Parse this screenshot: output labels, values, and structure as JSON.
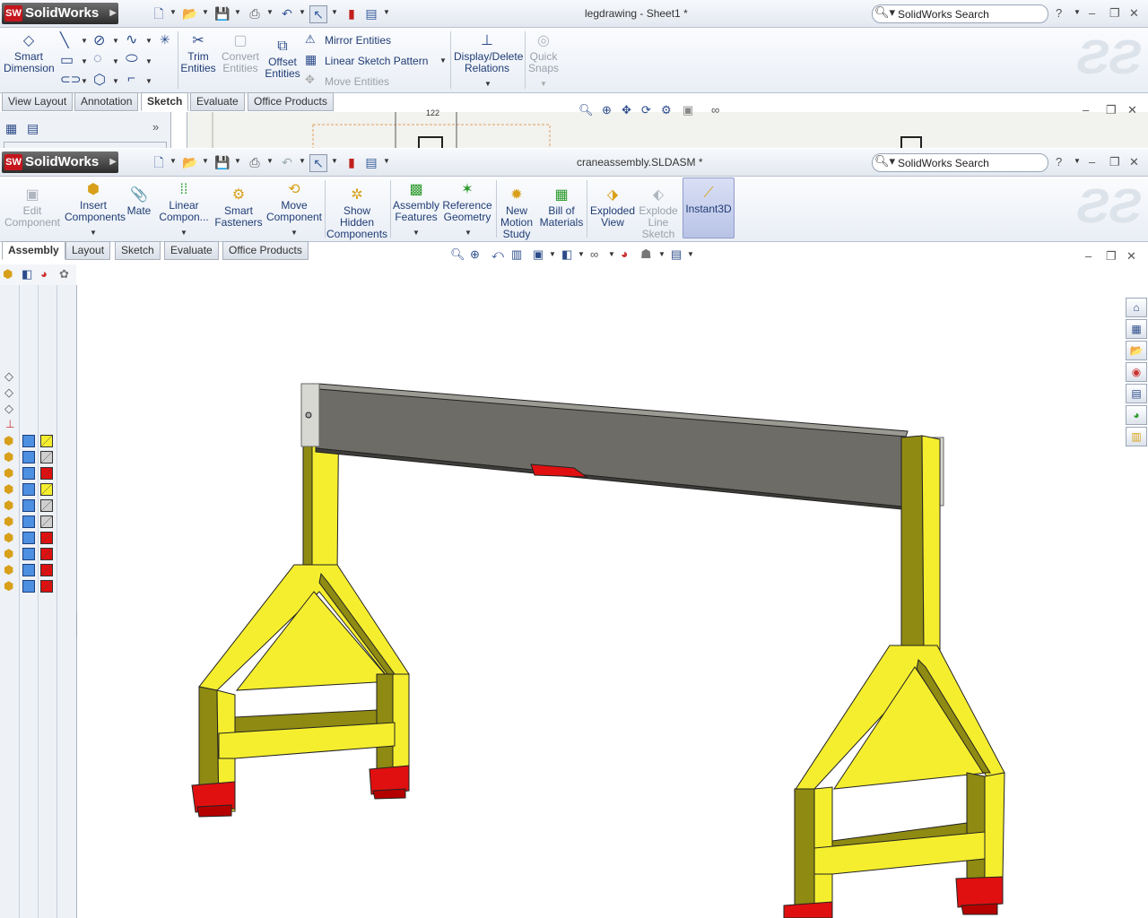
{
  "window1": {
    "app": "SolidWorks",
    "title": "legdrawing - Sheet1 *",
    "search_label": "SolidWorks Search",
    "commands": {
      "smart_dimension": "Smart Dimension",
      "trim": "Trim Entities",
      "convert": "Convert Entities",
      "offset": "Offset Entities",
      "mirror": "Mirror Entities",
      "linear_pattern": "Linear Sketch Pattern",
      "move": "Move Entities",
      "display_delete": "Display/Delete Relations",
      "quick_snaps": "Quick Snaps"
    },
    "tabs": [
      "View Layout",
      "Annotation",
      "Sketch",
      "Evaluate",
      "Office Products"
    ],
    "active_tab": "Sketch",
    "drawing_dim": "122"
  },
  "window2": {
    "app": "SolidWorks",
    "title": "craneassembly.SLDASM *",
    "search_label": "SolidWorks Search",
    "commands": {
      "edit_component": "Edit Component",
      "insert_components": "Insert Components",
      "mate": "Mate",
      "linear_component": "Linear Compon...",
      "smart_fasteners": "Smart Fasteners",
      "move_component": "Move Component",
      "show_hidden": "Show Hidden Components",
      "assembly_features": "Assembly Features",
      "reference_geometry": "Reference Geometry",
      "new_motion": "New Motion Study",
      "bill_of_materials": "Bill of Materials",
      "exploded_view": "Exploded View",
      "explode_line": "Explode Line Sketch",
      "instant3d": "Instant3D"
    },
    "tabs": [
      "Assembly",
      "Layout",
      "Sketch",
      "Evaluate",
      "Office Products"
    ],
    "active_tab": "Assembly"
  },
  "colors": {
    "leg": "#f5ee2e",
    "leg_shadow": "#8f8a12",
    "foot": "#e01010",
    "beam": "#6e6c66",
    "accent": "#2b4b8a"
  }
}
